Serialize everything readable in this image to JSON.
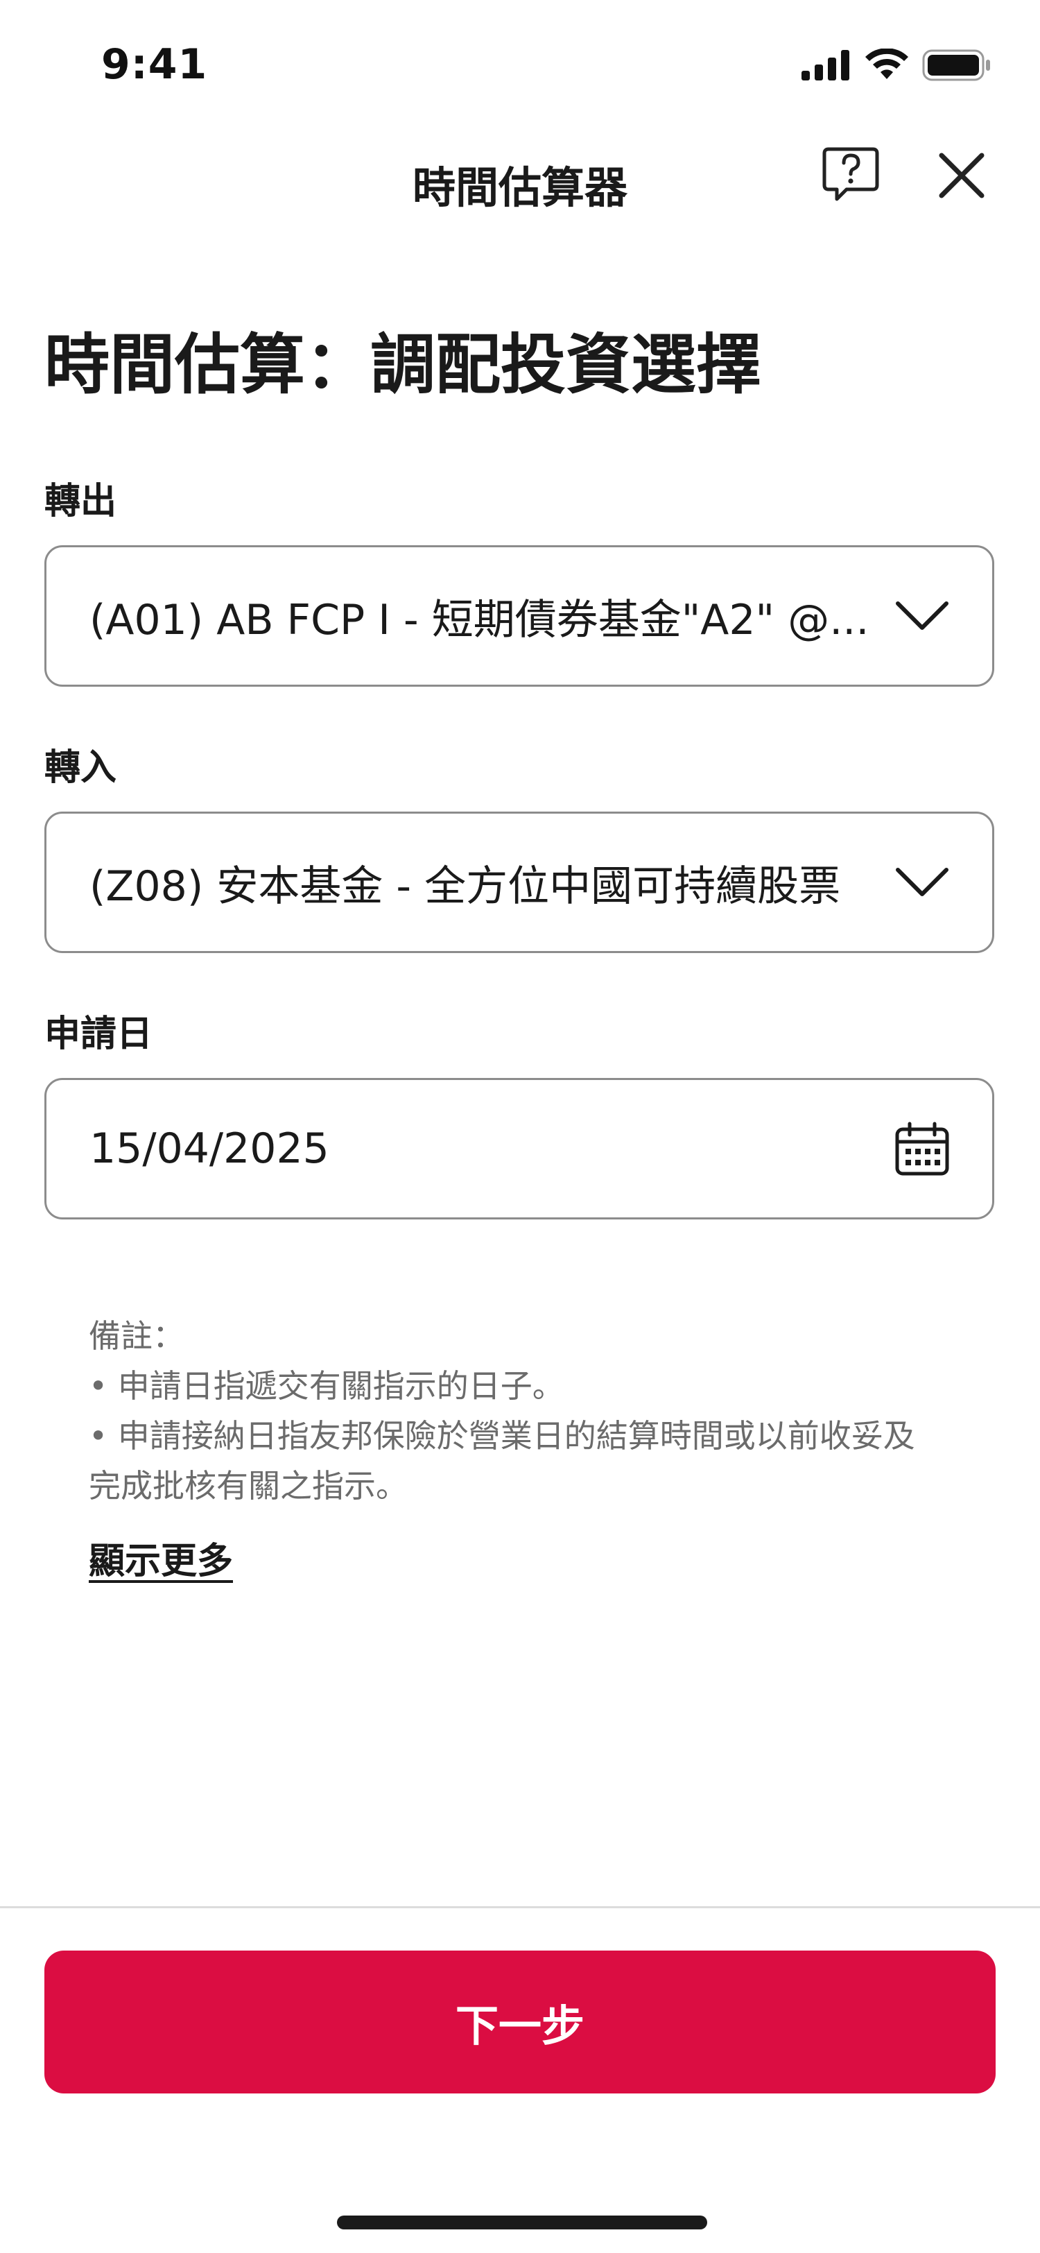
{
  "status_bar": {
    "time": "9:41",
    "icons": [
      "cellular-signal-icon",
      "wifi-icon",
      "battery-icon"
    ]
  },
  "header": {
    "title": "時間估算器",
    "help_icon": "help-question-icon",
    "close_icon": "close-icon"
  },
  "page": {
    "heading": "時間估算：調配投資選擇"
  },
  "form": {
    "transfer_out": {
      "label": "轉出",
      "value": "(A01) AB FCP I - 短期債券基金\"A2\" @...",
      "icon": "chevron-down-icon"
    },
    "transfer_in": {
      "label": "轉入",
      "value": "(Z08) 安本基金 - 全方位中國可持續股票",
      "icon": "chevron-down-icon"
    },
    "application_date": {
      "label": "申請日",
      "value": "15/04/2025",
      "icon": "calendar-icon"
    }
  },
  "notes": {
    "title": "備註：",
    "line1": "• 申請日指遞交有關指示的日子。",
    "line2": "• 申請接納日指友邦保險於營業日的結算時間或以前收妥及",
    "line3": "完成批核有關之指示。",
    "show_more": "顯示更多"
  },
  "footer": {
    "next_label": "下一步"
  },
  "colors": {
    "primary": "#db0d42",
    "text": "#1a1a1a",
    "muted": "#6b6b6b",
    "border": "#8c8c8c"
  }
}
